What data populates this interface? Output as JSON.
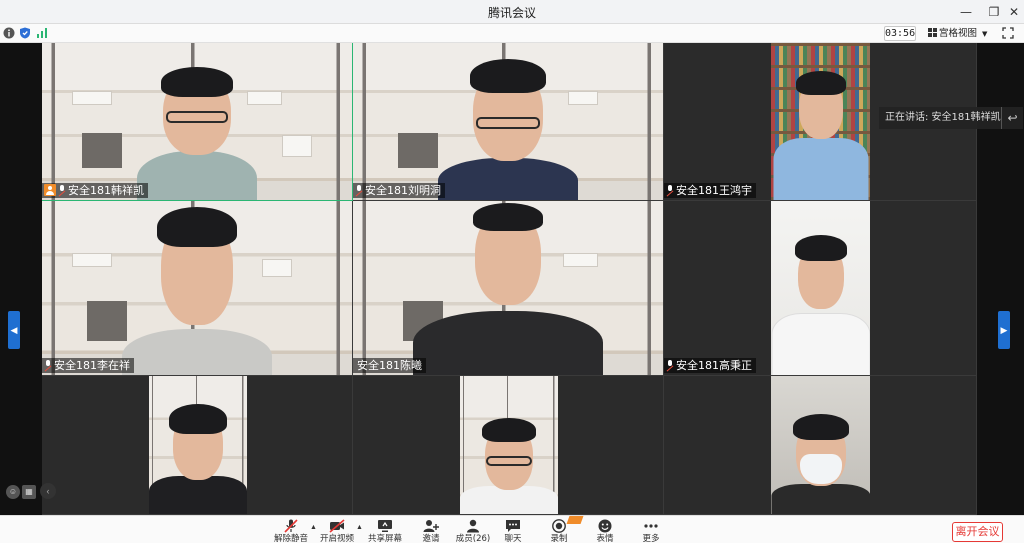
{
  "window": {
    "title": "腾讯会议"
  },
  "status": {
    "timer": "03:56",
    "view_label": "宫格视图"
  },
  "speaking": {
    "label": "正在讲话: 安全181韩祥凯"
  },
  "participants": [
    {
      "name": "安全181韩祥凯",
      "host": true
    },
    {
      "name": "安全181刘明洞",
      "host": false
    },
    {
      "name": "安全181王鸿宇",
      "host": false
    },
    {
      "name": "安全181李在祥",
      "host": false
    },
    {
      "name": "安全181陈曦",
      "host": false
    },
    {
      "name": "安全181高秉正",
      "host": false
    }
  ],
  "toolbar": {
    "unmute": "解除静音",
    "video": "开启视频",
    "share": "共享屏幕",
    "invite": "邀请",
    "members": "成员(26)",
    "chat": "聊天",
    "record": "录制",
    "emoji": "表情",
    "more": "更多",
    "leave": "离开会议"
  },
  "colors": {
    "accent": "#1f6fd1",
    "leave": "#e53935",
    "active_border": "#2bb673",
    "badge": "#f08c2a"
  }
}
